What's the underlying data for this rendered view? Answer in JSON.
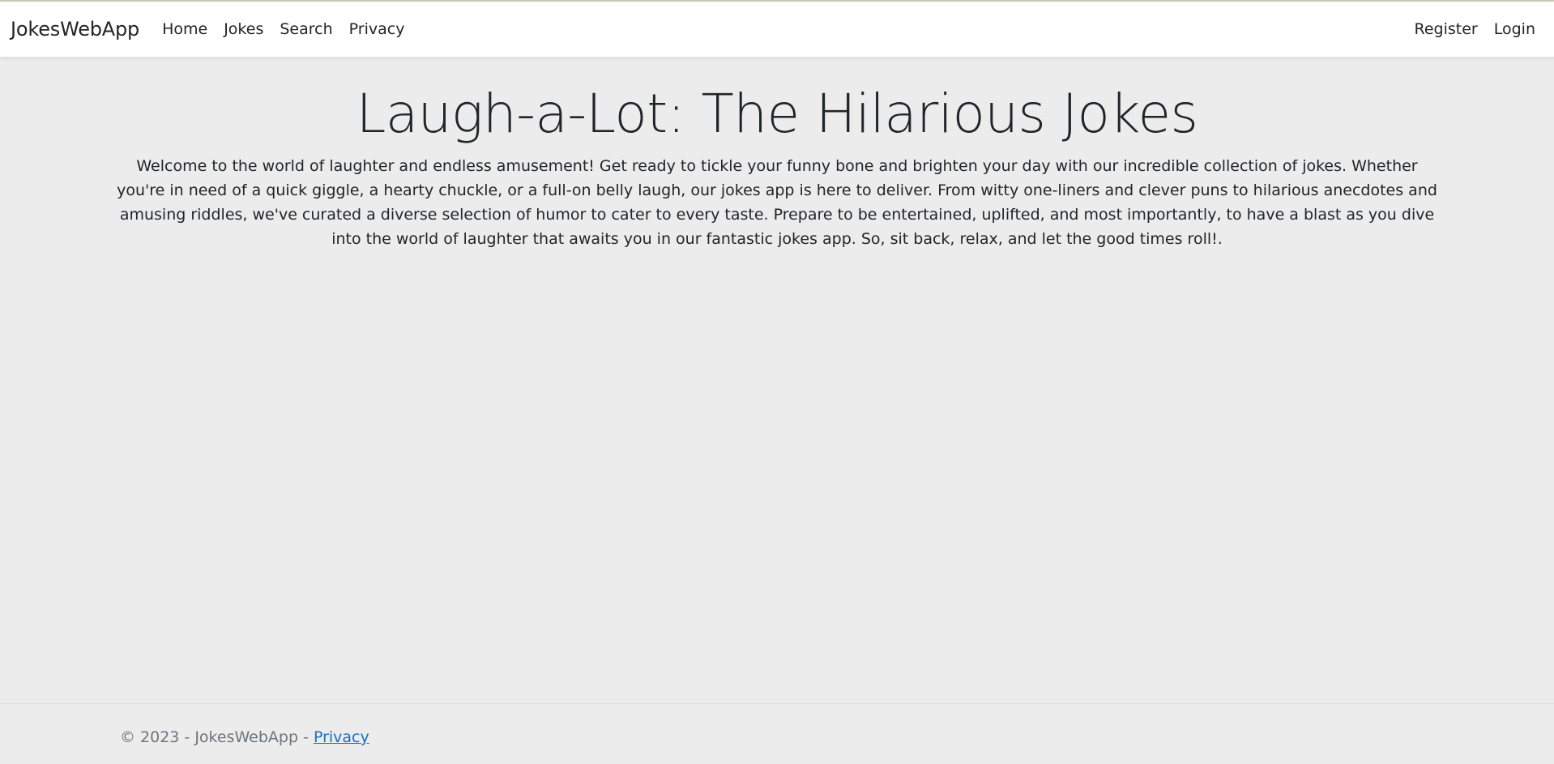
{
  "navbar": {
    "brand": "JokesWebApp",
    "links": [
      {
        "label": "Home"
      },
      {
        "label": "Jokes"
      },
      {
        "label": "Search"
      },
      {
        "label": "Privacy"
      }
    ],
    "auth": {
      "register": "Register",
      "login": "Login"
    }
  },
  "main": {
    "title": "Laugh-a-Lot: The Hilarious Jokes",
    "intro": "Welcome to the world of laughter and endless amusement! Get ready to tickle your funny bone and brighten your day with our incredible collection of jokes. Whether you're in need of a quick giggle, a hearty chuckle, or a full-on belly laugh, our jokes app is here to deliver. From witty one-liners and clever puns to hilarious anecdotes and amusing riddles, we've curated a diverse selection of humor to cater to every taste. Prepare to be entertained, uplifted, and most importantly, to have a blast as you dive into the world of laughter that awaits you in our fantastic jokes app. So, sit back, relax, and let the good times roll!."
  },
  "footer": {
    "copyright": "© 2023 - JokesWebApp - ",
    "privacy_link": "Privacy"
  },
  "colors": {
    "background": "#ececec",
    "navbar": "#ffffff",
    "text": "#212529",
    "muted": "#6c757d",
    "link": "#1b6ec2"
  }
}
